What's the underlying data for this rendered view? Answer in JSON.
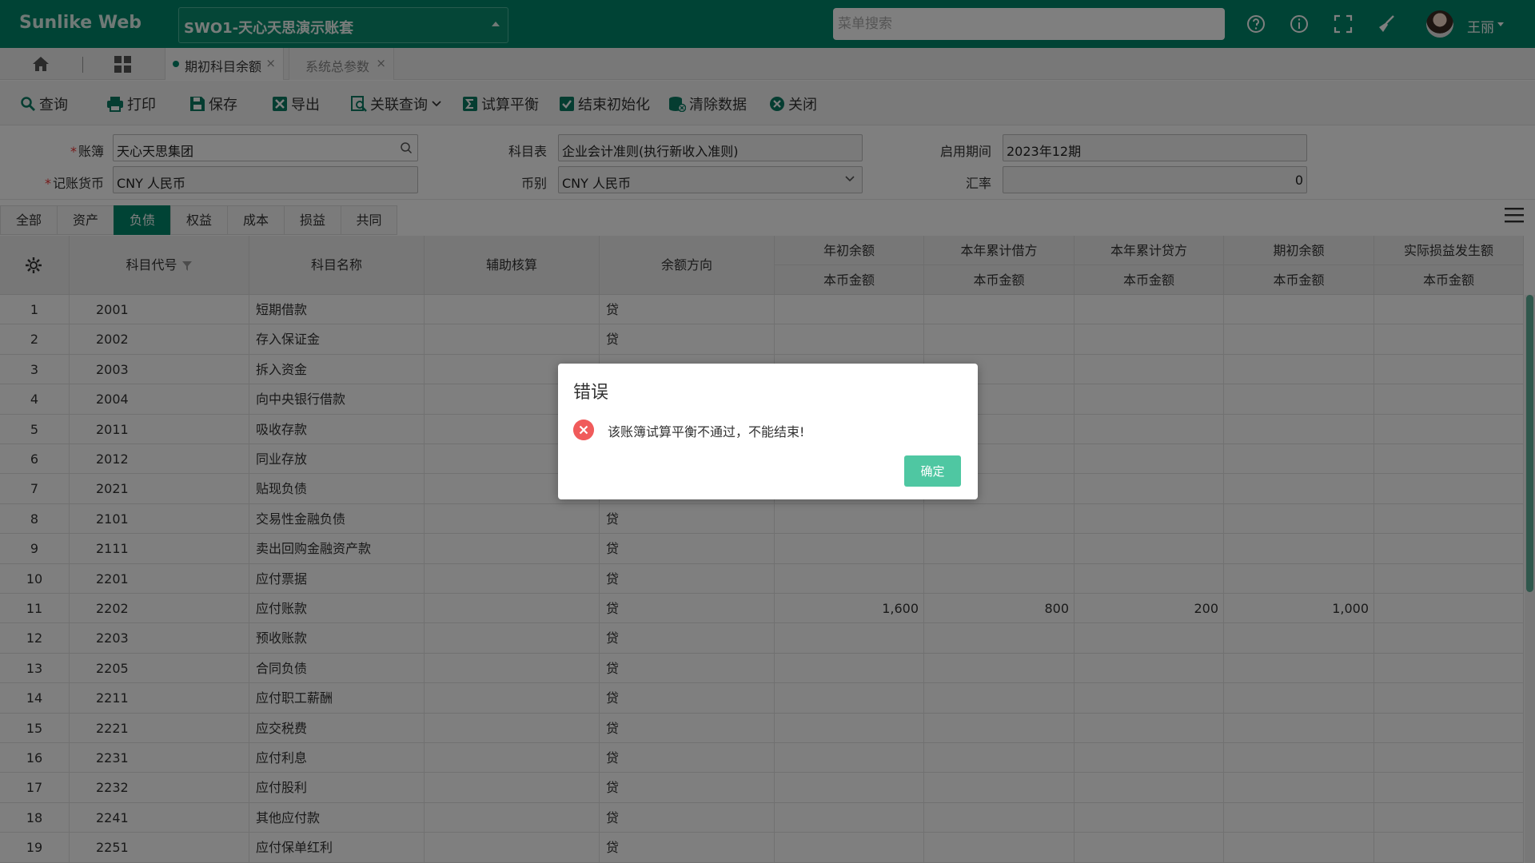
{
  "app": {
    "brand": "Sunlike Web",
    "account_set": "SWO1-天心天思演示账套",
    "search_placeholder": "菜单搜索",
    "user": "王丽"
  },
  "top_icons": [
    "help-icon",
    "info-icon",
    "fullscreen-icon",
    "broom-icon"
  ],
  "page_tabs": [
    {
      "label": "期初科目余额",
      "active": true
    },
    {
      "label": "系统总参数",
      "active": false
    }
  ],
  "toolbar": {
    "query": "查询",
    "print": "打印",
    "save": "保存",
    "export": "导出",
    "related": "关联查询",
    "trial": "试算平衡",
    "finish": "结束初始化",
    "clear": "清除数据",
    "close": "关闭"
  },
  "form": {
    "book_label": "账簿",
    "book_value": "天心天思集团",
    "chart_label": "科目表",
    "chart_value": "企业会计准则(执行新收入准则)",
    "period_label": "启用期间",
    "period_value": "2023年12期",
    "currency_label": "记账货币",
    "currency_value": "CNY 人民币",
    "coin_label": "币别",
    "coin_value": "CNY 人民币",
    "rate_label": "汇率",
    "rate_value": "0"
  },
  "categories": [
    "全部",
    "资产",
    "负债",
    "权益",
    "成本",
    "损益",
    "共同"
  ],
  "active_category": "负债",
  "table": {
    "headers": {
      "code": "科目代号",
      "name": "科目名称",
      "aux": "辅助核算",
      "dir": "余额方向",
      "year_open": "年初余额",
      "debit": "本年累计借方",
      "credit": "本年累计贷方",
      "period_open": "期初余额",
      "actual": "实际损益发生额",
      "sub": "本币金额"
    },
    "rows": [
      {
        "n": "1",
        "code": "2001",
        "name": "短期借款",
        "dir": "贷"
      },
      {
        "n": "2",
        "code": "2002",
        "name": "存入保证金",
        "dir": "贷"
      },
      {
        "n": "3",
        "code": "2003",
        "name": "拆入资金",
        "dir": ""
      },
      {
        "n": "4",
        "code": "2004",
        "name": "向中央银行借款",
        "dir": ""
      },
      {
        "n": "5",
        "code": "2011",
        "name": "吸收存款",
        "dir": ""
      },
      {
        "n": "6",
        "code": "2012",
        "name": "同业存放",
        "dir": ""
      },
      {
        "n": "7",
        "code": "2021",
        "name": "贴现负债",
        "dir": ""
      },
      {
        "n": "8",
        "code": "2101",
        "name": "交易性金融负债",
        "dir": "贷"
      },
      {
        "n": "9",
        "code": "2111",
        "name": "卖出回购金融资产款",
        "dir": "贷"
      },
      {
        "n": "10",
        "code": "2201",
        "name": "应付票据",
        "dir": "贷"
      },
      {
        "n": "11",
        "code": "2202",
        "name": "应付账款",
        "dir": "贷",
        "year_open": "1,600",
        "debit": "800",
        "credit": "200",
        "period_open": "1,000"
      },
      {
        "n": "12",
        "code": "2203",
        "name": "预收账款",
        "dir": "贷"
      },
      {
        "n": "13",
        "code": "2205",
        "name": "合同负债",
        "dir": "贷"
      },
      {
        "n": "14",
        "code": "2211",
        "name": "应付职工薪酬",
        "dir": "贷"
      },
      {
        "n": "15",
        "code": "2221",
        "name": "应交税费",
        "dir": "贷"
      },
      {
        "n": "16",
        "code": "2231",
        "name": "应付利息",
        "dir": "贷"
      },
      {
        "n": "17",
        "code": "2232",
        "name": "应付股利",
        "dir": "贷"
      },
      {
        "n": "18",
        "code": "2241",
        "name": "其他应付款",
        "dir": "贷"
      },
      {
        "n": "19",
        "code": "2251",
        "name": "应付保单红利",
        "dir": "贷"
      }
    ]
  },
  "dialog": {
    "title": "错误",
    "message": "该账簿试算平衡不通过，不能结束!",
    "ok": "确定"
  },
  "colors": {
    "brand": "#00876a",
    "ok_button": "#4fc7a2",
    "error": "#f05b5b"
  }
}
